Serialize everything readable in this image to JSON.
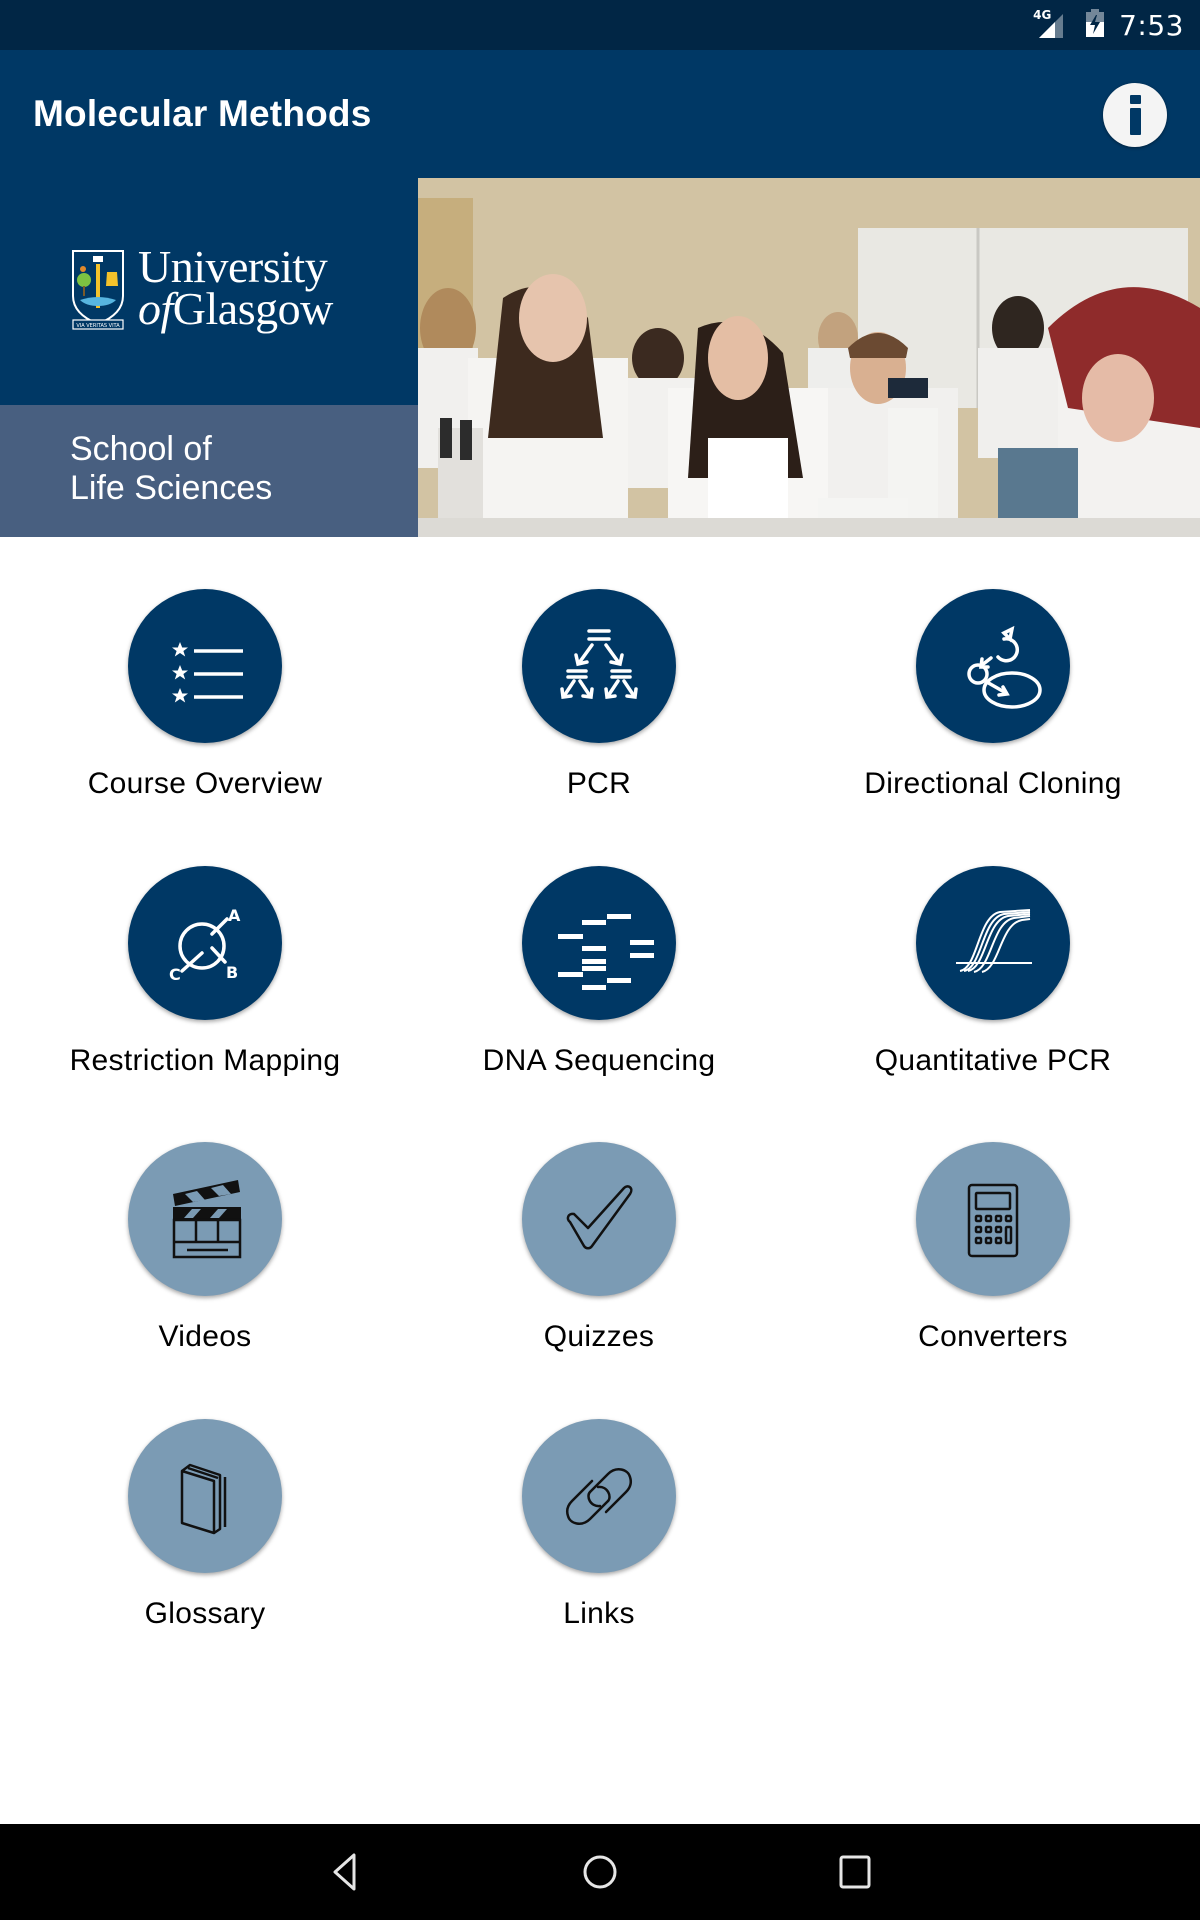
{
  "status_bar": {
    "network": "4G",
    "time": "7:53",
    "icons": [
      "signal-icon",
      "battery-charging-icon"
    ]
  },
  "app_bar": {
    "title": "Molecular Methods",
    "info_icon": "info-icon"
  },
  "banner": {
    "university_line1": "University",
    "university_of": "of",
    "university_line2": "Glasgow",
    "crest_motto": "VIA VERITAS VITA",
    "school_line1": "School of",
    "school_line2": "Life Sciences",
    "photo_alt": "Students in lab coats working with microscopes and pipettes"
  },
  "menu": {
    "items": [
      {
        "label": "Course Overview",
        "icon": "starred-list-icon",
        "style": "dark"
      },
      {
        "label": "PCR",
        "icon": "pcr-amplification-icon",
        "style": "dark"
      },
      {
        "label": "Directional Cloning",
        "icon": "cloning-icon",
        "style": "dark"
      },
      {
        "label": "Restriction Mapping",
        "icon": "restriction-map-icon",
        "style": "dark"
      },
      {
        "label": "DNA Sequencing",
        "icon": "sequencing-gel-icon",
        "style": "dark"
      },
      {
        "label": "Quantitative PCR",
        "icon": "amplification-curves-icon",
        "style": "dark"
      },
      {
        "label": "Videos",
        "icon": "clapperboard-icon",
        "style": "light"
      },
      {
        "label": "Quizzes",
        "icon": "checkmark-icon",
        "style": "light"
      },
      {
        "label": "Converters",
        "icon": "calculator-icon",
        "style": "light"
      },
      {
        "label": "Glossary",
        "icon": "book-icon",
        "style": "light"
      },
      {
        "label": "Links",
        "icon": "chain-link-icon",
        "style": "light"
      }
    ],
    "restriction_labels": {
      "a": "A",
      "b": "B",
      "c": "C"
    }
  },
  "nav_bar": {
    "buttons": [
      "back",
      "home",
      "recents"
    ]
  },
  "colors": {
    "status_bar": "#012645",
    "app_bar": "#003865",
    "brand_navy": "#003865",
    "school_slate": "#485f80",
    "tile_dark": "#003865",
    "tile_light": "#7b9bb4"
  }
}
